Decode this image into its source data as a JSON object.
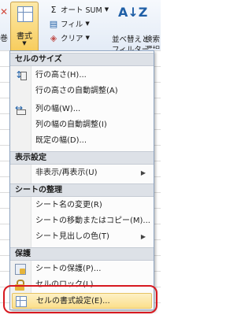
{
  "ribbon": {
    "left_fragment": "巻",
    "format_button": {
      "label": "書式"
    },
    "edit_rows": [
      {
        "icon": "sigma-icon",
        "label": "オート SUM"
      },
      {
        "icon": "fill-icon",
        "label": "フィル"
      },
      {
        "icon": "eraser-icon",
        "label": "クリア"
      }
    ],
    "sort_filter": {
      "line1": "並べ替えと",
      "line2": "フィルター"
    },
    "find_select": {
      "line1": "検索",
      "line2": "選択"
    }
  },
  "menu": {
    "sections": [
      {
        "header": "セルのサイズ",
        "items": [
          {
            "label": "行の高さ(H)...",
            "icon": "row-height-icon"
          },
          {
            "label": "行の高さの自動調整(A)",
            "icon": ""
          },
          {
            "label": "列の幅(W)...",
            "icon": "column-width-icon"
          },
          {
            "label": "列の幅の自動調整(I)",
            "icon": ""
          },
          {
            "label": "既定の幅(D)...",
            "icon": ""
          }
        ]
      },
      {
        "header": "表示設定",
        "items": [
          {
            "label": "非表示/再表示(U)",
            "icon": "",
            "submenu": true
          }
        ]
      },
      {
        "header": "シートの整理",
        "items": [
          {
            "label": "シート名の変更(R)",
            "icon": ""
          },
          {
            "label": "シートの移動またはコピー(M)...",
            "icon": ""
          },
          {
            "label": "シート見出しの色(T)",
            "icon": "",
            "submenu": true
          }
        ]
      },
      {
        "header": "保護",
        "items": [
          {
            "label": "シートの保護(P)...",
            "icon": "sheet-protect-icon"
          },
          {
            "label": "セルのロック(L)",
            "icon": "lock-icon"
          },
          {
            "label": "セルの書式設定(E)...",
            "icon": "format-cells-icon",
            "highlighted": true
          }
        ]
      }
    ]
  },
  "colors": {
    "highlight": "#fbdf8b",
    "section_header_bg": "#dde1e7",
    "annotation": "#d71920"
  }
}
